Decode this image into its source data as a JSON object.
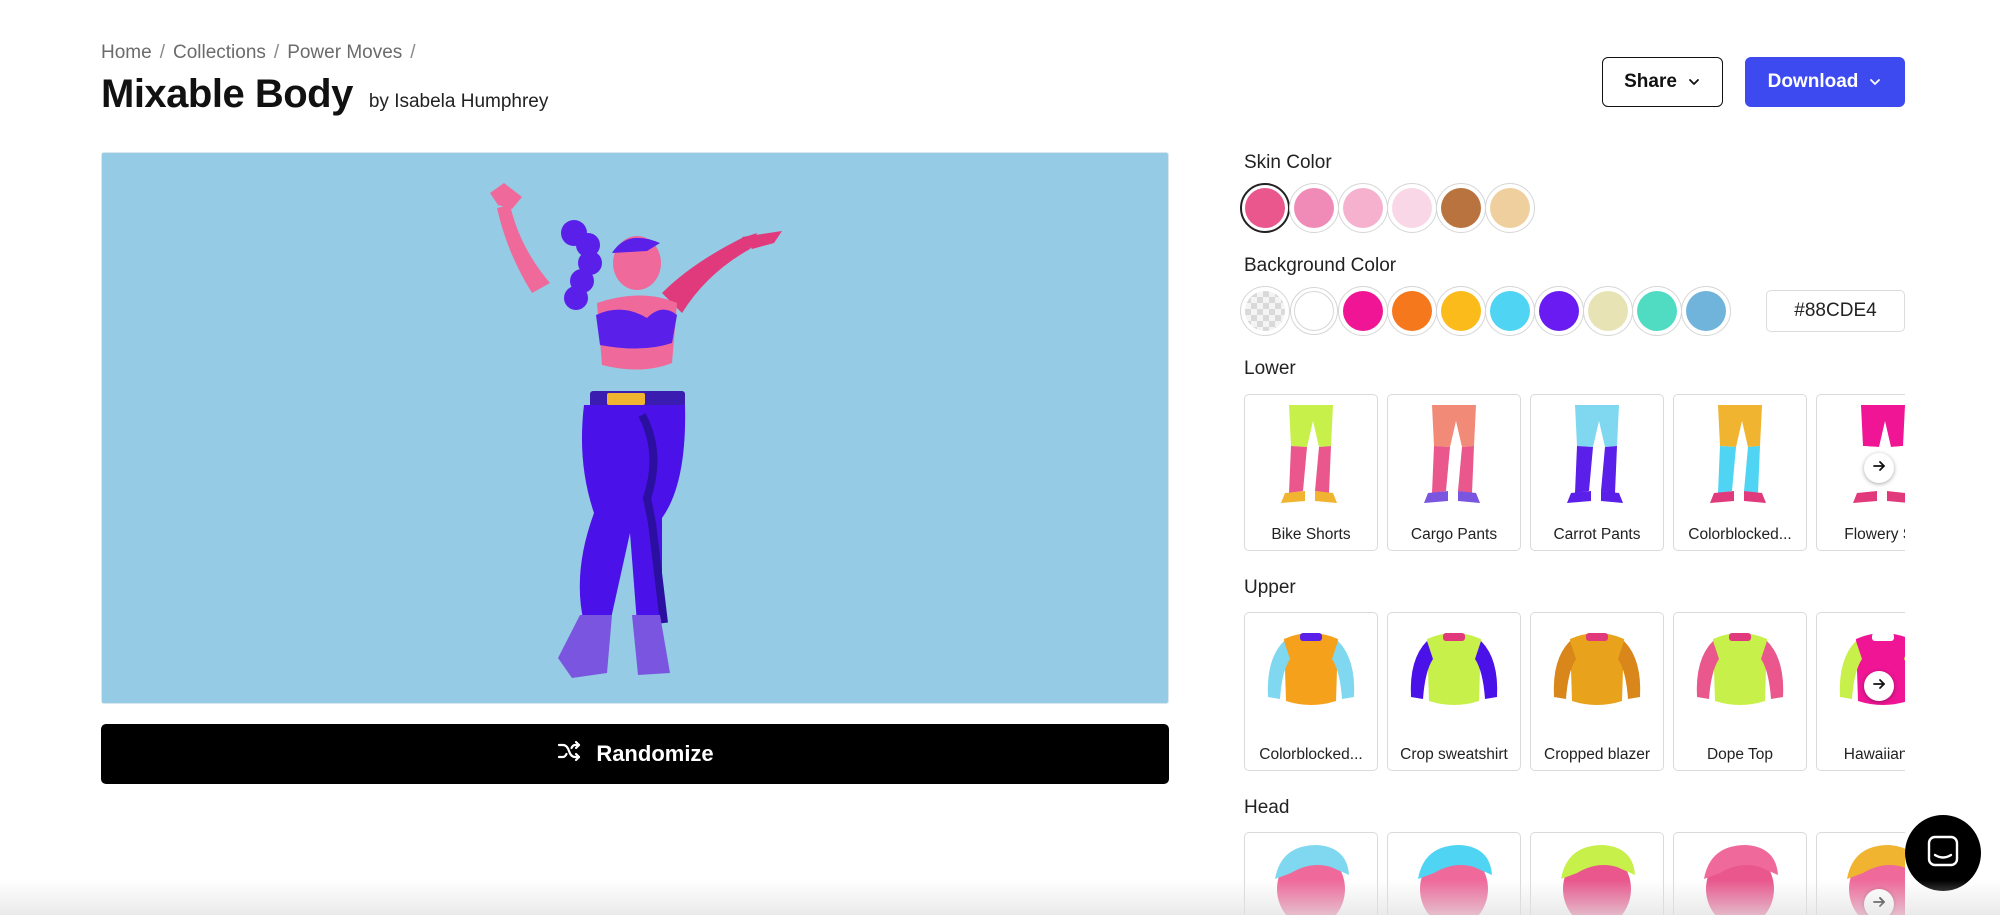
{
  "breadcrumb": {
    "items": [
      "Home",
      "Collections",
      "Power Moves"
    ],
    "separator": "/"
  },
  "header": {
    "title": "Mixable Body",
    "author": "by Isabela Humphrey"
  },
  "actions": {
    "share_label": "Share",
    "download_label": "Download"
  },
  "preview": {
    "background_color": "#95CBE4",
    "randomize_label": "Randomize"
  },
  "skin": {
    "label": "Skin Color",
    "colors": [
      "#E9578D",
      "#F08BB8",
      "#F5B1CE",
      "#FAD7E6",
      "#B9733E",
      "#F0CF9F"
    ],
    "selected_index": 0
  },
  "background": {
    "label": "Background Color",
    "colors": [
      "transparent",
      "#FFFFFF",
      "#EF1595",
      "#F6781C",
      "#FABB1B",
      "#4FD4F3",
      "#6A1BF2",
      "#E8E3B5",
      "#4FDCC2",
      "#71B4DB"
    ],
    "hex_value": "#88CDE4"
  },
  "lower": {
    "label": "Lower",
    "items": [
      "Bike Shorts",
      "Cargo Pants",
      "Carrot Pants",
      "Colorblocked...",
      "Flowery Sh"
    ]
  },
  "upper": {
    "label": "Upper",
    "items": [
      "Colorblocked...",
      "Crop sweatshirt",
      "Cropped blazer",
      "Dope Top",
      "Hawaiian S"
    ]
  },
  "head": {
    "label": "Head",
    "items": [
      "",
      "",
      "",
      "",
      ""
    ]
  },
  "icons": {
    "chevron": "chevron-down-icon",
    "shuffle": "shuffle-icon",
    "arrow": "arrow-right-icon",
    "chat": "chat-icon"
  },
  "colors": {
    "accent": "#3D4AF0",
    "figure_purple": "#5A1FE8",
    "figure_pink": "#EF6A9A"
  }
}
